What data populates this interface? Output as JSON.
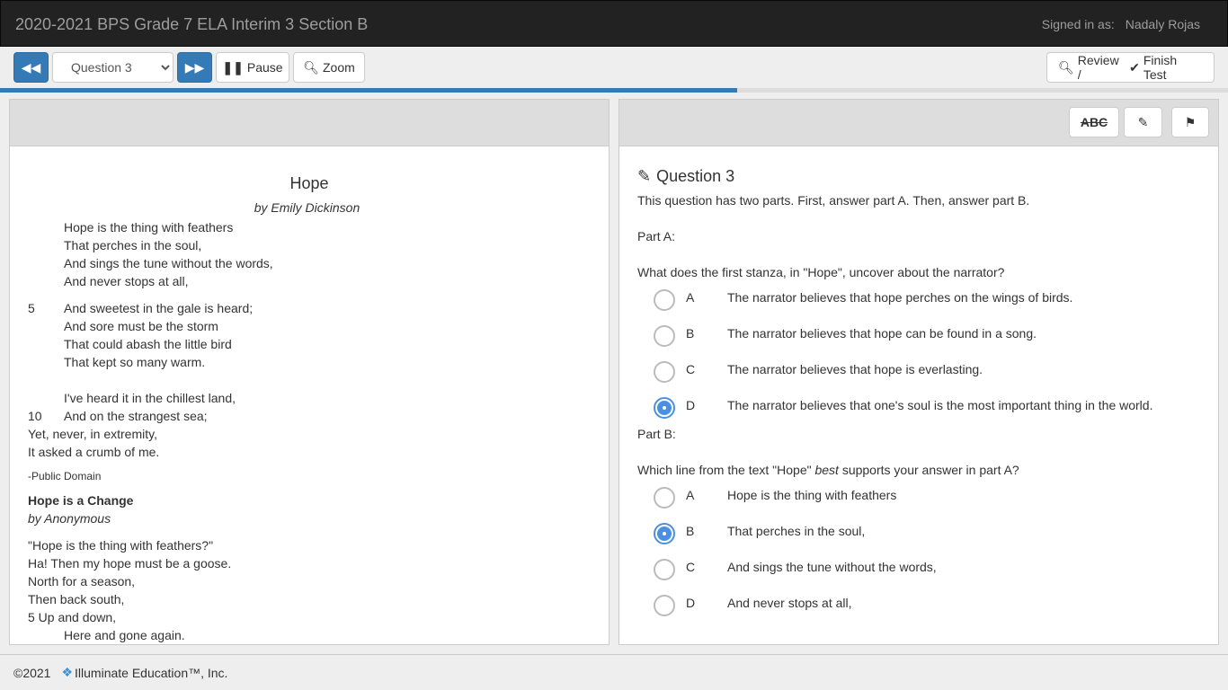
{
  "header": {
    "title": "2020-2021 BPS Grade 7 ELA Interim 3 Section B",
    "signed_label": "Signed in as:",
    "user": "Nadaly Rojas"
  },
  "toolbar": {
    "question_select": "Question 3",
    "pause": "Pause",
    "zoom": "Zoom",
    "review": "Review /",
    "finish": "Finish Test"
  },
  "progress": {
    "percent": 60
  },
  "passage": {
    "title": "Hope",
    "byline": "by Emily Dickinson",
    "stanzas": [
      [
        {
          "n": "",
          "t": "Hope is the thing with feathers"
        },
        {
          "n": "",
          "t": "That perches in the soul,"
        },
        {
          "n": "",
          "t": "And sings the tune without the words,"
        },
        {
          "n": "",
          "t": "And never stops at all,"
        }
      ],
      [
        {
          "n": "5",
          "t": "And sweetest in the gale is heard;"
        },
        {
          "n": "",
          "t": "And sore must be the storm"
        },
        {
          "n": "",
          "t": "That could abash the little bird"
        },
        {
          "n": "",
          "t": "That kept so many warm."
        }
      ],
      [
        {
          "n": "",
          "t": "I've heard it in the chillest land,"
        },
        {
          "n": "10",
          "t": "And on the strangest sea;"
        }
      ]
    ],
    "flush_lines": [
      "Yet, never, in extremity,",
      "It asked a crumb of me."
    ],
    "credit": "-Public Domain",
    "title2": "Hope is a Change",
    "byline2": "by Anonymous",
    "poem2": [
      "\"Hope is the thing with feathers?\"",
      "Ha! Then my hope must be a goose.",
      "North for a season,",
      "Then back south,",
      "5 Up and down,"
    ],
    "poem2_indented": "Here and gone again."
  },
  "question": {
    "title": "Question 3",
    "intro": "This question has two parts. First, answer part A. Then, answer part B.",
    "partA": {
      "label": "Part A:",
      "prompt": "What does the first stanza, in \"Hope\", uncover about the narrator?",
      "options": [
        {
          "letter": "A",
          "text": "The narrator believes that hope perches on the wings of birds.",
          "selected": false
        },
        {
          "letter": "B",
          "text": "The narrator believes that hope can be found in a song.",
          "selected": false
        },
        {
          "letter": "C",
          "text": "The narrator believes that hope is everlasting.",
          "selected": false
        },
        {
          "letter": "D",
          "text": "The narrator believes that one's soul is the most important thing in the world.",
          "selected": true
        }
      ]
    },
    "partB": {
      "label": "Part B:",
      "prompt_pre": "Which line from the text \"Hope\" ",
      "prompt_em": "best",
      "prompt_post": " supports your answer in part A?",
      "options": [
        {
          "letter": "A",
          "text": "Hope is the thing with feathers",
          "selected": false
        },
        {
          "letter": "B",
          "text": "That perches in the soul,",
          "selected": true
        },
        {
          "letter": "C",
          "text": "And sings the tune without the words,",
          "selected": false
        },
        {
          "letter": "D",
          "text": "And never stops at all,",
          "selected": false
        }
      ]
    },
    "tools": {
      "strike": "ABC"
    }
  },
  "footer": {
    "copyright": "©2021",
    "company": "Illuminate Education™, Inc."
  },
  "colors": {
    "primary": "#337ab7",
    "radio": "#4a90e2"
  }
}
